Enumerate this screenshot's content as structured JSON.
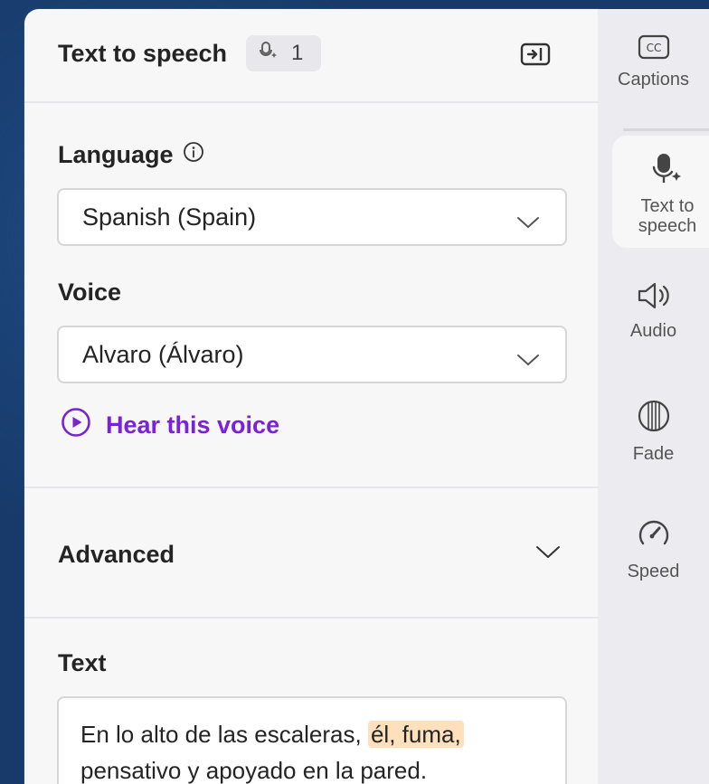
{
  "panel": {
    "title": "Text to speech",
    "badge_count": "1",
    "language": {
      "label": "Language",
      "selected": "Spanish (Spain)"
    },
    "voice": {
      "label": "Voice",
      "selected": "Alvaro (Álvaro)"
    },
    "hear_voice_label": "Hear this voice",
    "advanced_label": "Advanced",
    "text": {
      "label": "Text",
      "before_highlight": "En lo alto de las escaleras, ",
      "highlight": "él, fuma,",
      "after_highlight": " pensativo y apoyado en la pared."
    }
  },
  "rail": {
    "items": [
      {
        "label": "Captions",
        "icon": "captions-icon"
      },
      {
        "label": "Text to speech",
        "icon": "text-to-speech-icon",
        "active": true
      },
      {
        "label": "Audio",
        "icon": "audio-icon"
      },
      {
        "label": "Fade",
        "icon": "fade-icon"
      },
      {
        "label": "Speed",
        "icon": "speed-icon"
      }
    ]
  },
  "colors": {
    "accent": "#7a22d6",
    "highlight": "#ffe0bc",
    "panel_bg": "#f7f7f8",
    "rail_bg": "#ececf0"
  }
}
